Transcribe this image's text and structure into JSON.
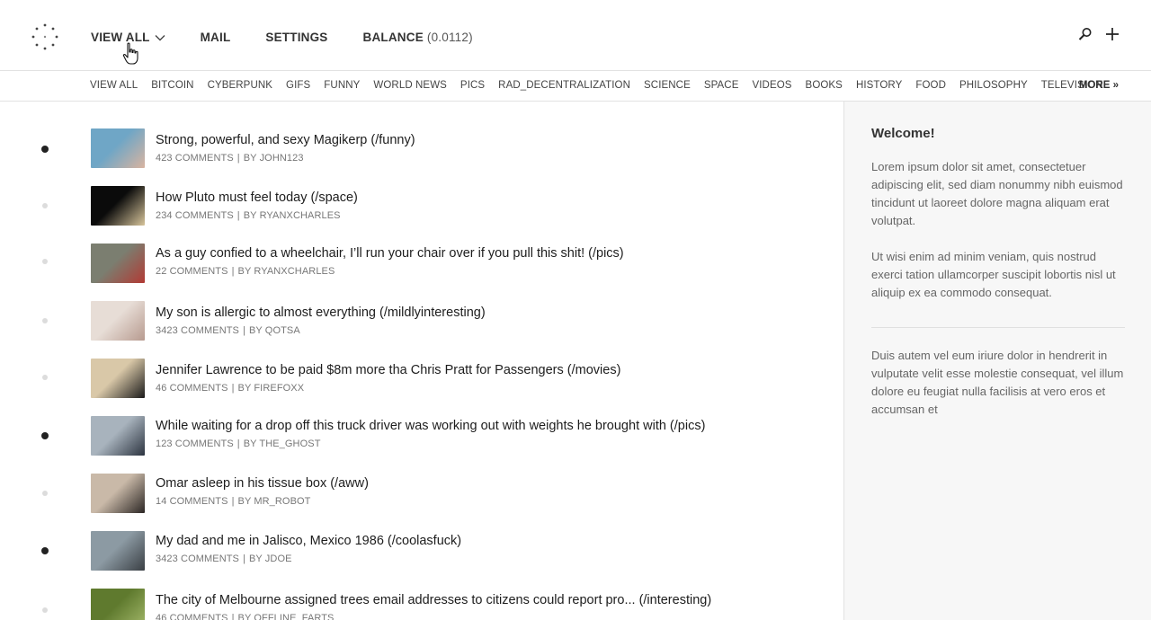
{
  "header": {
    "nav": [
      {
        "label": "VIEW ALL"
      },
      {
        "label": "MAIL"
      },
      {
        "label": "SETTINGS"
      },
      {
        "label": "BALANCE",
        "value": "(0.0112)"
      }
    ]
  },
  "categories": [
    "VIEW ALL",
    "BITCOIN",
    "CYBERPUNK",
    "GIFS",
    "FUNNY",
    "WORLD NEWS",
    "PICS",
    "RAD_DECENTRALIZATION",
    "SCIENCE",
    "SPACE",
    "VIDEOS",
    "BOOKS",
    "HISTORY",
    "FOOD",
    "PHILOSOPHY",
    "TELEVISION"
  ],
  "more_label": "MORE »",
  "posts": [
    {
      "title": "Strong, powerful, and sexy Magikerp (/funny)",
      "comments": "423 COMMENTS",
      "by": "BY JOHN123",
      "active": true,
      "thumb": [
        "#6fa6c6",
        "#d9b4a0"
      ]
    },
    {
      "title": "How Pluto must feel today (/space)",
      "comments": "234 COMMENTS",
      "by": "BY RYANXCHARLES",
      "active": false,
      "thumb": [
        "#0b0b0b",
        "#d8c59b"
      ]
    },
    {
      "title": "As a guy confied to a wheelchair, I’ll run your chair over if you pull this shit! (/pics)",
      "comments": "22 COMMENTS",
      "by": "BY RYANXCHARLES",
      "active": false,
      "thumb": [
        "#7b7e70",
        "#b23a34"
      ]
    },
    {
      "title": "My son is allergic to almost everything (/mildlyinteresting)",
      "comments": "3423 COMMENTS",
      "by": "BY QOTSA",
      "active": false,
      "thumb": [
        "#e7ddd6",
        "#b79a8f"
      ]
    },
    {
      "title": "Jennifer Lawrence to be paid $8m more tha Chris Pratt for Passengers (/movies)",
      "comments": "46 COMMENTS",
      "by": "BY FIREFOXX",
      "active": false,
      "thumb": [
        "#d9c8a8",
        "#1a1a1a"
      ]
    },
    {
      "title": "While waiting for a drop off this truck driver was working out with weights he brought with  (/pics)",
      "comments": "123 COMMENTS",
      "by": "BY THE_GHOST",
      "active": true,
      "thumb": [
        "#a8b3bd",
        "#2c3440"
      ]
    },
    {
      "title": "Omar asleep in his tissue box (/aww)",
      "comments": "14 COMMENTS",
      "by": "BY MR_ROBOT",
      "active": false,
      "thumb": [
        "#c9b9a8",
        "#2b2624"
      ]
    },
    {
      "title": "My dad and me in Jalisco, Mexico 1986 (/coolasfuck)",
      "comments": "3423 COMMENTS",
      "by": "BY JDOE",
      "active": true,
      "thumb": [
        "#8c9aa3",
        "#3a3f44"
      ]
    },
    {
      "title": "The city of Melbourne assigned trees email addresses to citizens could report pro... (/interesting)",
      "comments": "46 COMMENTS",
      "by": "BY OFFLINE_FARTS",
      "active": false,
      "thumb": [
        "#5f7a2e",
        "#a3b86a"
      ]
    }
  ],
  "sidebar": {
    "title": "Welcome!",
    "p1": "Lorem ipsum dolor sit amet, consectetuer adipiscing elit, sed diam nonummy nibh euismod tincidunt ut laoreet dolore magna aliquam erat volutpat.",
    "p2": "Ut wisi enim ad minim veniam, quis nostrud exerci tation ullamcorper suscipit lobortis nisl ut aliquip ex ea commodo consequat.",
    "p3": "Duis autem vel eum iriure dolor in hendrerit in vulputate velit esse molestie consequat, vel illum dolore eu feugiat nulla facilisis at vero eros et accumsan et"
  }
}
